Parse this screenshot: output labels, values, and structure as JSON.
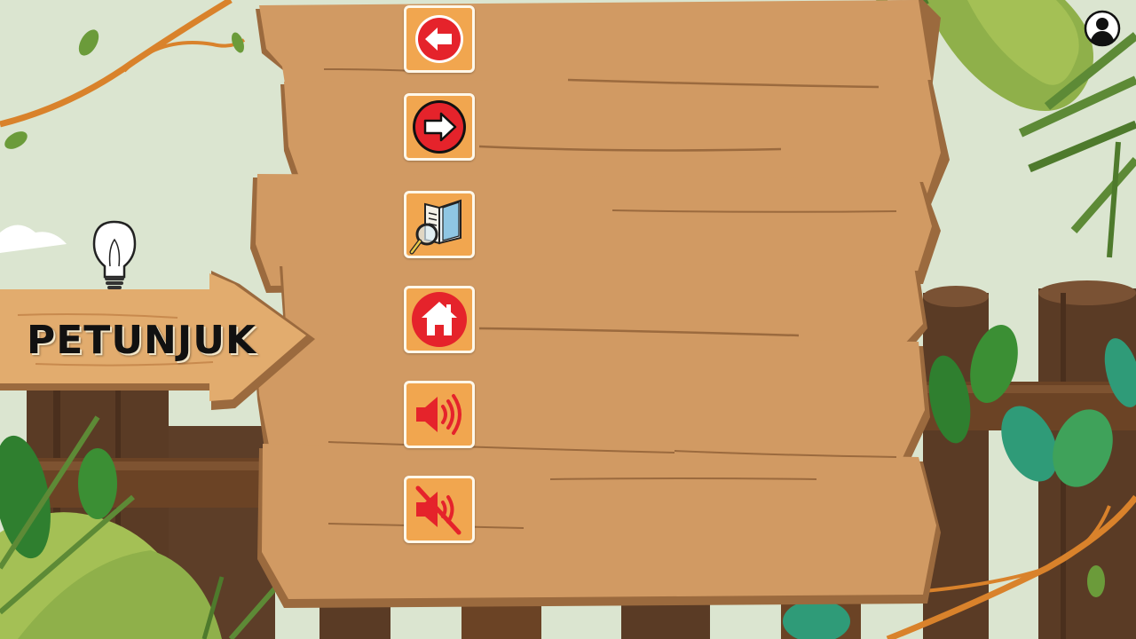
{
  "sign": {
    "label": "PETUNJUK"
  },
  "buttons": [
    {
      "name": "back-button",
      "icon": "arrow-left-icon"
    },
    {
      "name": "next-button",
      "icon": "arrow-right-icon"
    },
    {
      "name": "guide-button",
      "icon": "book-magnifier-icon"
    },
    {
      "name": "home-button",
      "icon": "home-icon"
    },
    {
      "name": "sound-on-button",
      "icon": "speaker-on-icon"
    },
    {
      "name": "sound-off-button",
      "icon": "speaker-muted-icon"
    }
  ],
  "profile": {
    "icon": "user-profile-icon"
  },
  "colors": {
    "wood": "#d19a63",
    "wood_dark": "#9b6a3e",
    "button_bg": "#f1a64f",
    "button_border": "#fff8ea",
    "icon_red": "#e5232b",
    "leaf_light": "#a4c055",
    "leaf_dark": "#5d8a36",
    "leaf_teal": "#2f9b78"
  }
}
